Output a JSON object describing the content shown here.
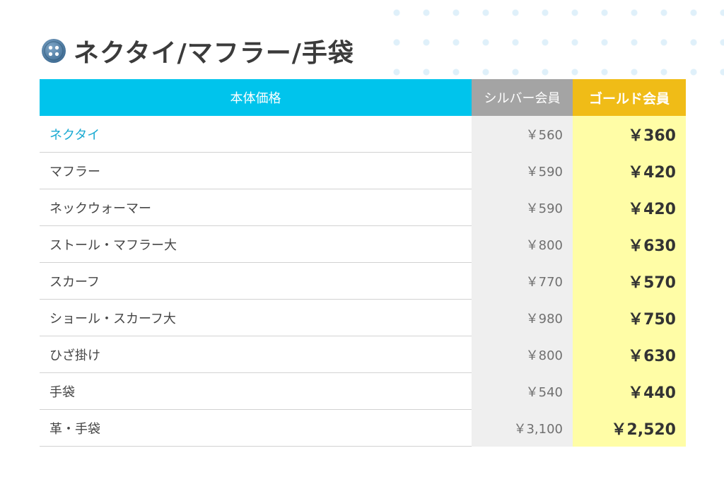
{
  "page": {
    "title": "ネクタイ/マフラー/手袋",
    "icon": "button-icon"
  },
  "colors": {
    "header_item": "#00c4ec",
    "header_silver": "#a4a4a4",
    "header_gold": "#f0bc17",
    "silver_cell": "#efefef",
    "gold_cell": "#fffda6",
    "link_text": "#1aaad2"
  },
  "table": {
    "headers": {
      "item": "本体価格",
      "silver": "シルバー会員",
      "gold": "ゴールド会員"
    },
    "rows": [
      {
        "item": "ネクタイ",
        "silver": "￥560",
        "gold": "￥360"
      },
      {
        "item": "マフラー",
        "silver": "￥590",
        "gold": "￥420"
      },
      {
        "item": "ネックウォーマー",
        "silver": "￥590",
        "gold": "￥420"
      },
      {
        "item": "ストール・マフラー大",
        "silver": "￥800",
        "gold": "￥630"
      },
      {
        "item": "スカーフ",
        "silver": "￥770",
        "gold": "￥570"
      },
      {
        "item": "ショール・スカーフ大",
        "silver": "￥980",
        "gold": "￥750"
      },
      {
        "item": "ひざ掛け",
        "silver": "￥800",
        "gold": "￥630"
      },
      {
        "item": "手袋",
        "silver": "￥540",
        "gold": "￥440"
      },
      {
        "item": "革・手袋",
        "silver": "￥3,100",
        "gold": "￥2,520"
      }
    ]
  }
}
